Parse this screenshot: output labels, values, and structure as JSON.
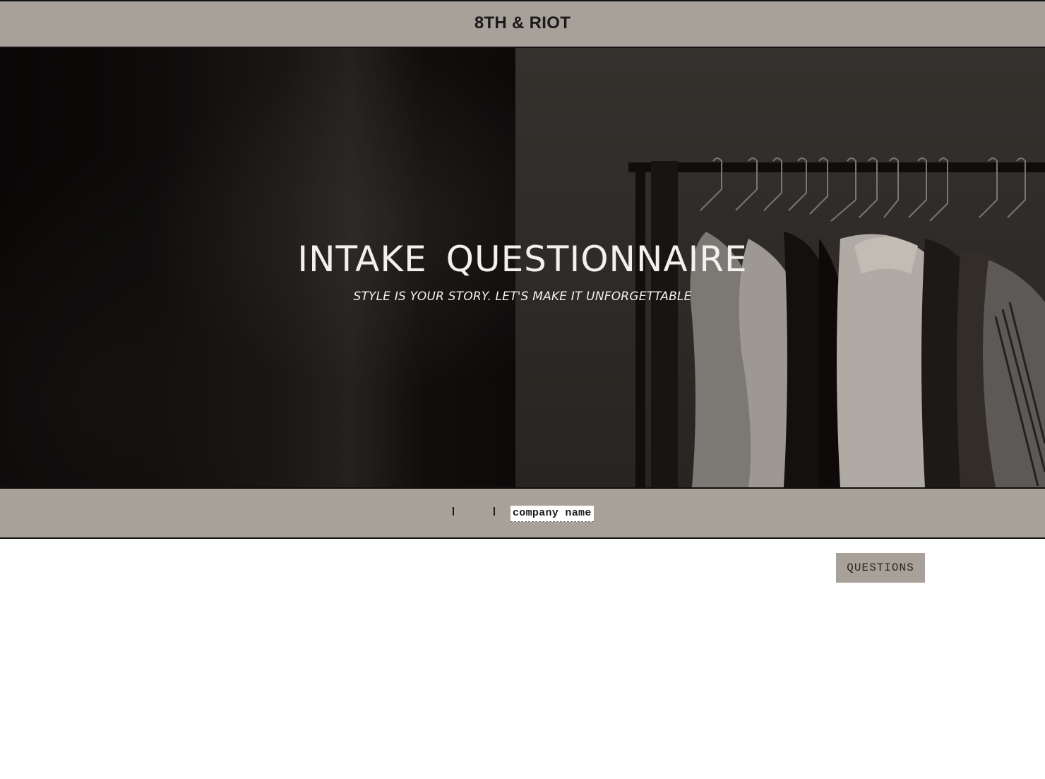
{
  "header": {
    "brand": "8TH & RIOT"
  },
  "hero": {
    "title": "INTAKE  QUESTIONNAIRE",
    "subtitle": "STYLE IS YOUR STORY. LET'S MAKE IT UNFORGETTABLE"
  },
  "secondary_bar": {
    "company_field": "company name"
  },
  "actions": {
    "questions_label": "QUESTIONS"
  },
  "colors": {
    "bar_background": "#a8a199",
    "border": "#111111",
    "hero_text": "#f3f1ee"
  }
}
